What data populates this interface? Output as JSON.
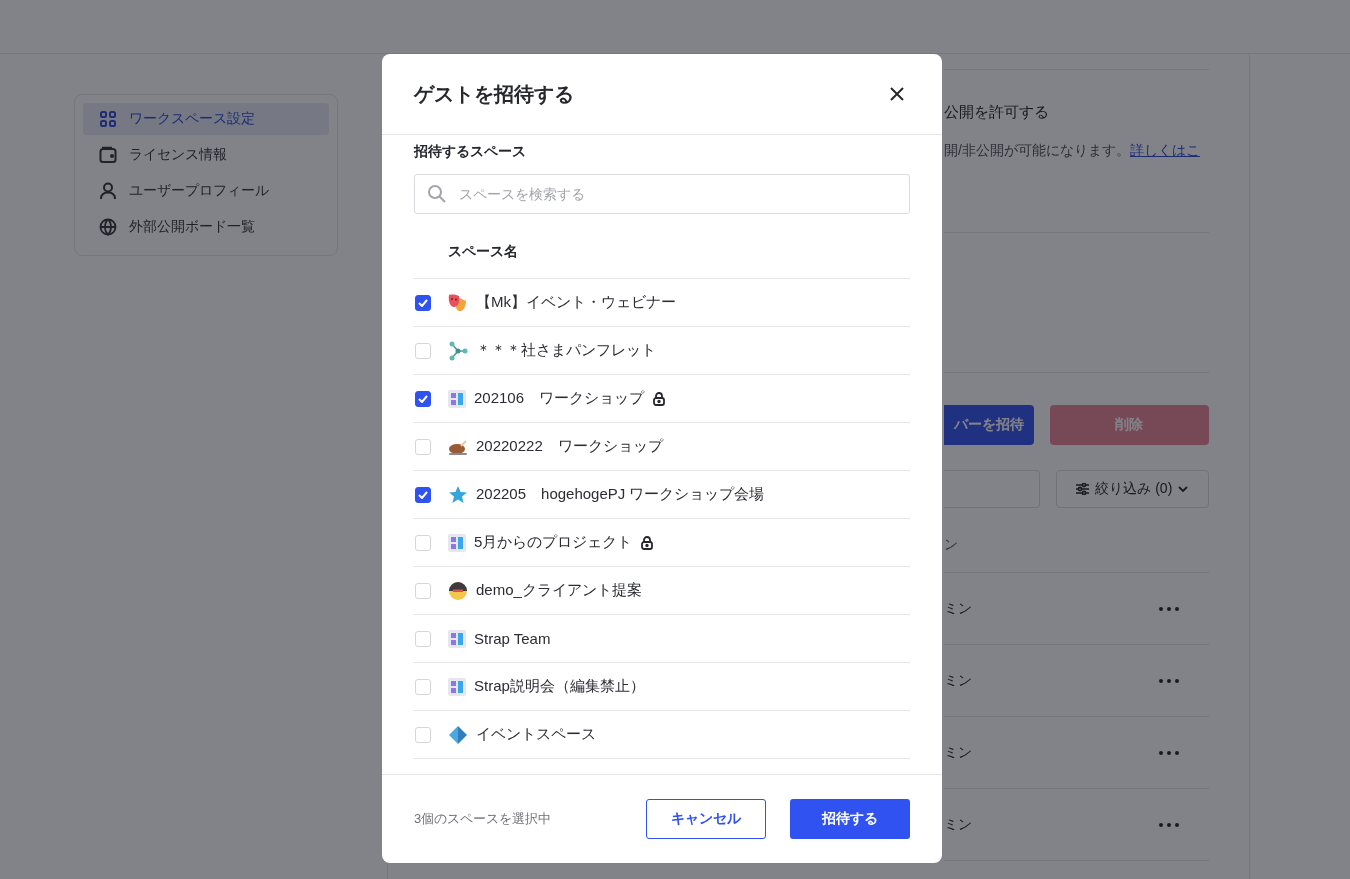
{
  "sidebar": {
    "items": [
      {
        "label": "ワークスペース設定",
        "selected": true
      },
      {
        "label": "ライセンス情報",
        "selected": false
      },
      {
        "label": "ユーザープロフィール",
        "selected": false
      },
      {
        "label": "外部公開ボード一覧",
        "selected": false
      }
    ]
  },
  "main": {
    "setting_title": "公開を許可する",
    "setting_description": "開/非公開が可能になります。",
    "setting_link": "詳しくはこ",
    "invite_button": "バーを招待",
    "delete_button": "削除",
    "filter_button": "絞り込み (0)",
    "column_header": "ン",
    "rows": [
      {
        "role": "ミン"
      },
      {
        "role": "ミン"
      },
      {
        "role": "ミン"
      },
      {
        "role": "ミン"
      }
    ]
  },
  "modal": {
    "title": "ゲストを招待する",
    "section_label": "招待するスペース",
    "search": {
      "placeholder": "スペースを検索する"
    },
    "column_header": "スペース名",
    "spaces": [
      {
        "name": "【Mk】イベント・ウェビナー",
        "checked": true,
        "locked": false
      },
      {
        "name": "＊＊＊社さまパンフレット",
        "checked": false,
        "locked": false
      },
      {
        "name": "202106　ワークショップ",
        "checked": true,
        "locked": true
      },
      {
        "name": "20220222　ワークショップ",
        "checked": false,
        "locked": false
      },
      {
        "name": "202205　hogehogePJ ワークショップ会場",
        "checked": true,
        "locked": false
      },
      {
        "name": "5月からのプロジェクト",
        "checked": false,
        "locked": true
      },
      {
        "name": "demo_クライアント提案",
        "checked": false,
        "locked": false
      },
      {
        "name": "Strap Team",
        "checked": false,
        "locked": false
      },
      {
        "name": "Strap説明会（編集禁止）",
        "checked": false,
        "locked": false
      },
      {
        "name": "イベントスペース",
        "checked": false,
        "locked": false
      }
    ],
    "selection_count": "3個のスペースを選択中",
    "cancel_button": "キャンセル",
    "submit_button": "招待する"
  }
}
